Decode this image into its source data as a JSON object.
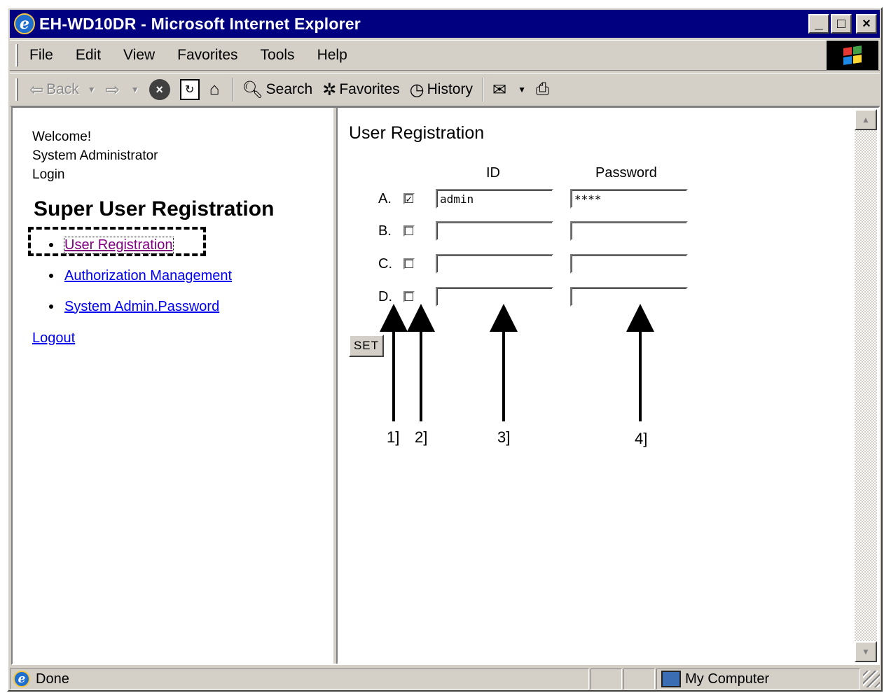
{
  "window": {
    "title": "EH-WD10DR - Microsoft Internet Explorer"
  },
  "window_buttons": {
    "minimize": "_",
    "maximize": "□",
    "close": "×"
  },
  "menu": [
    "File",
    "Edit",
    "View",
    "Favorites",
    "Tools",
    "Help"
  ],
  "toolbar": {
    "back": "Back",
    "search": "Search",
    "favorites": "Favorites",
    "history": "History"
  },
  "left": {
    "greeting": [
      "Welcome!",
      "System Administrator",
      "Login"
    ],
    "section_title": "Super User Registration",
    "nav": [
      "User Registration",
      "Authorization Management",
      "System Admin.Password"
    ],
    "logout": "Logout"
  },
  "right": {
    "title": "User Registration",
    "col_id": "ID",
    "col_password": "Password",
    "rows": [
      {
        "label": "A.",
        "checked": true,
        "id": "admin",
        "password": "****"
      },
      {
        "label": "B.",
        "checked": false,
        "id": "",
        "password": ""
      },
      {
        "label": "C.",
        "checked": false,
        "id": "",
        "password": ""
      },
      {
        "label": "D.",
        "checked": false,
        "id": "",
        "password": ""
      }
    ],
    "set_label": "SET",
    "callouts": [
      "1]",
      "2]",
      "3]",
      "4]"
    ]
  },
  "status": {
    "text": "Done",
    "zone": "My Computer"
  }
}
